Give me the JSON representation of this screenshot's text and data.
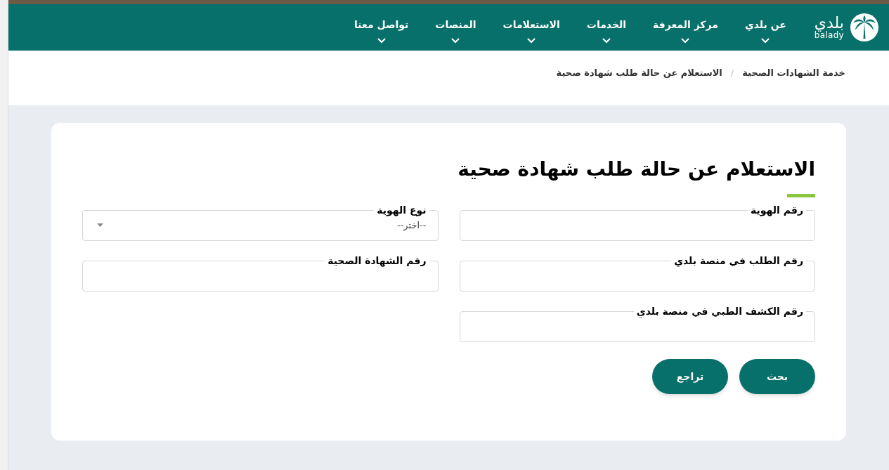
{
  "header": {
    "logo": {
      "arabic": "بلدي",
      "latin": "balady"
    },
    "nav": [
      {
        "label": "عن بلدي"
      },
      {
        "label": "مركز المعرفة"
      },
      {
        "label": "الخدمات"
      },
      {
        "label": "الاستعلامات"
      },
      {
        "label": "المنصات"
      },
      {
        "label": "تواصل معنا"
      }
    ]
  },
  "breadcrumb": {
    "separator": "/",
    "items": [
      "خدمة الشهادات الصحية",
      "الاستعلام عن حالة طلب شهادة صحية"
    ]
  },
  "form": {
    "title": "الاستعلام عن حالة طلب شهادة صحية",
    "fields": [
      {
        "kind": "text",
        "label": "رقم الهوية"
      },
      {
        "kind": "select",
        "label": "نوع الهوية",
        "placeholder": "--اختر--"
      },
      {
        "kind": "text",
        "label": "رقم الطلب في منصة بلدي"
      },
      {
        "kind": "text",
        "label": "رقم الشهادة الصحية"
      },
      {
        "kind": "text",
        "label": "رقم الكشف الطبي في منصة بلدي"
      }
    ],
    "buttons": [
      "بحث",
      "تراجع"
    ]
  }
}
